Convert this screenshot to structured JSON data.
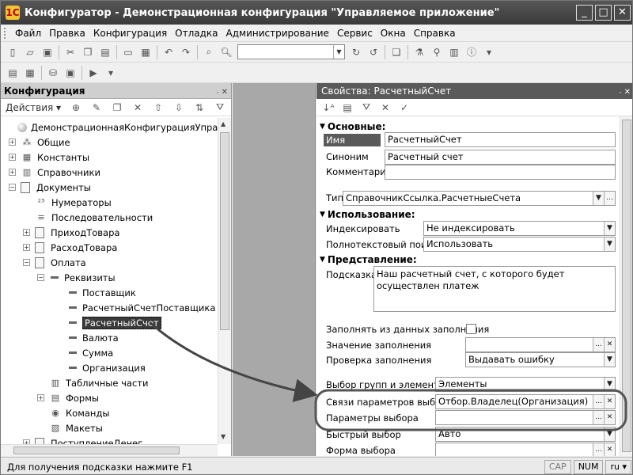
{
  "window": {
    "title": "Конфигуратор - Демонстрационная конфигурация \"Управляемое приложение\"",
    "app_icon": "1C",
    "buttons": [
      "_",
      "□",
      "✕"
    ]
  },
  "menu": [
    "Файл",
    "Правка",
    "Конфигурация",
    "Отладка",
    "Администрирование",
    "Сервис",
    "Окна",
    "Справка"
  ],
  "left_panel": {
    "title": "Конфигурация",
    "actions_label": "Действия",
    "tree": [
      {
        "label": "ДемонстрационнаяКонфигурацияУправляемо",
        "level": 0,
        "expander": "",
        "icon": "dot"
      },
      {
        "label": "Общие",
        "level": 1,
        "expander": "+",
        "icon": "shapes"
      },
      {
        "label": "Константы",
        "level": 1,
        "expander": "+",
        "icon": "grid"
      },
      {
        "label": "Справочники",
        "level": 1,
        "expander": "+",
        "icon": "table"
      },
      {
        "label": "Документы",
        "level": 1,
        "expander": "−",
        "icon": "doc"
      },
      {
        "label": "Нумераторы",
        "level": 2,
        "expander": "",
        "icon": "num"
      },
      {
        "label": "Последовательности",
        "level": 2,
        "expander": "",
        "icon": "seq"
      },
      {
        "label": "ПриходТовара",
        "level": 2,
        "expander": "+",
        "icon": "doc"
      },
      {
        "label": "РасходТовара",
        "level": 2,
        "expander": "+",
        "icon": "doc"
      },
      {
        "label": "Оплата",
        "level": 2,
        "expander": "−",
        "icon": "doc"
      },
      {
        "label": "Реквизиты",
        "level": 3,
        "expander": "−",
        "icon": "bar"
      },
      {
        "label": "Поставщик",
        "level": 4,
        "expander": "",
        "icon": "bar"
      },
      {
        "label": "РасчетныйСчетПоставщика",
        "level": 4,
        "expander": "",
        "icon": "bar"
      },
      {
        "label": "РасчетныйСчет",
        "level": 4,
        "expander": "",
        "icon": "bar",
        "selected": true
      },
      {
        "label": "Валюта",
        "level": 4,
        "expander": "",
        "icon": "bar"
      },
      {
        "label": "Сумма",
        "level": 4,
        "expander": "",
        "icon": "bar"
      },
      {
        "label": "Организация",
        "level": 4,
        "expander": "",
        "icon": "bar"
      },
      {
        "label": "Табличные части",
        "level": 3,
        "expander": "",
        "icon": "table"
      },
      {
        "label": "Формы",
        "level": 3,
        "expander": "+",
        "icon": "form"
      },
      {
        "label": "Команды",
        "level": 3,
        "expander": "",
        "icon": "cmd"
      },
      {
        "label": "Макеты",
        "level": 3,
        "expander": "",
        "icon": "layout"
      },
      {
        "label": "ПоступлениеДенег",
        "level": 2,
        "expander": "+",
        "icon": "doc"
      }
    ]
  },
  "properties": {
    "title": "Свойства: РасчетныйСчет",
    "sections": {
      "basic": "Основные:",
      "usage": "Использование:",
      "presentation": "Представление:"
    },
    "fields": {
      "name": {
        "label": "Имя",
        "value": "РасчетныйСчет"
      },
      "synonym": {
        "label": "Синоним",
        "value": "Расчетный счет"
      },
      "comment": {
        "label": "Комментарий",
        "value": ""
      },
      "type": {
        "label": "Тип",
        "value": "СправочникСсылка.РасчетныеСчета"
      },
      "indexing": {
        "label": "Индексировать",
        "value": "Не индексировать"
      },
      "fulltext": {
        "label": "Полнотекстовый поиск",
        "value": "Использовать"
      },
      "tooltip": {
        "label": "Подсказка",
        "value": "Наш расчетный счет, с которого будет осуществлен платеж"
      },
      "fill_from": {
        "label": "Заполнять из данных заполнения"
      },
      "fill_value": {
        "label": "Значение заполнения",
        "value": ""
      },
      "fill_check": {
        "label": "Проверка заполнения",
        "value": "Выдавать ошибку"
      },
      "choice_groups": {
        "label": "Выбор групп и элементов",
        "value": "Элементы"
      },
      "choice_links": {
        "label": "Связи параметров выбора",
        "value": "Отбор.Владелец(Организация)"
      },
      "choice_params": {
        "label": "Параметры выбора",
        "value": ""
      },
      "quick_choice": {
        "label": "Быстрый выбор",
        "value": "Авто"
      },
      "choice_form": {
        "label": "Форма выбора",
        "value": ""
      }
    }
  },
  "status": {
    "hint": "Для получения подсказки нажмите F1",
    "cap": "CAP",
    "num": "NUM",
    "lang": "ru"
  }
}
